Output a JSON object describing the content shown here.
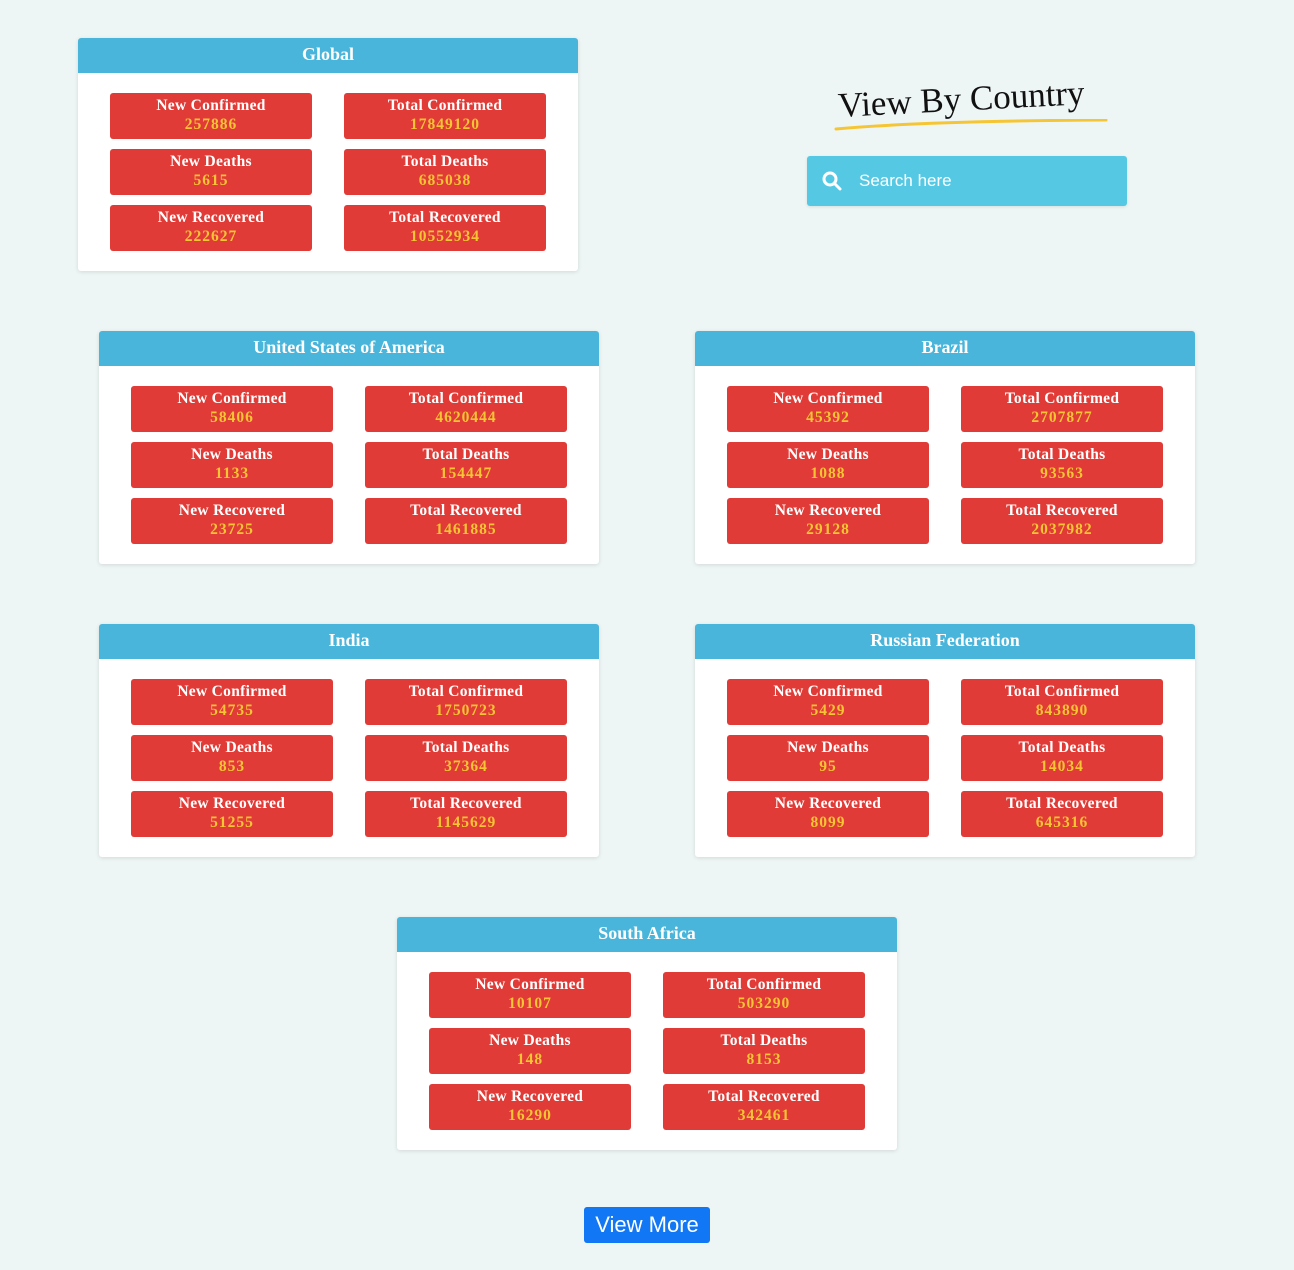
{
  "search": {
    "title": "View By Country",
    "placeholder": "Search here"
  },
  "labels": {
    "new_confirmed": "New Confirmed",
    "total_confirmed": "Total Confirmed",
    "new_deaths": "New Deaths",
    "total_deaths": "Total Deaths",
    "new_recovered": "New Recovered",
    "total_recovered": "Total Recovered"
  },
  "global": {
    "name": "Global",
    "new_confirmed": "257886",
    "total_confirmed": "17849120",
    "new_deaths": "5615",
    "total_deaths": "685038",
    "new_recovered": "222627",
    "total_recovered": "10552934"
  },
  "countries": [
    {
      "name": "United States of America",
      "new_confirmed": "58406",
      "total_confirmed": "4620444",
      "new_deaths": "1133",
      "total_deaths": "154447",
      "new_recovered": "23725",
      "total_recovered": "1461885"
    },
    {
      "name": "Brazil",
      "new_confirmed": "45392",
      "total_confirmed": "2707877",
      "new_deaths": "1088",
      "total_deaths": "93563",
      "new_recovered": "29128",
      "total_recovered": "2037982"
    },
    {
      "name": "India",
      "new_confirmed": "54735",
      "total_confirmed": "1750723",
      "new_deaths": "853",
      "total_deaths": "37364",
      "new_recovered": "51255",
      "total_recovered": "1145629"
    },
    {
      "name": "Russian Federation",
      "new_confirmed": "5429",
      "total_confirmed": "843890",
      "new_deaths": "95",
      "total_deaths": "14034",
      "new_recovered": "8099",
      "total_recovered": "645316"
    },
    {
      "name": "South Africa",
      "new_confirmed": "10107",
      "total_confirmed": "503290",
      "new_deaths": "148",
      "total_deaths": "8153",
      "new_recovered": "16290",
      "total_recovered": "342461"
    }
  ],
  "view_more_label": "View More",
  "colors": {
    "header": "#4ab5da",
    "stat_bg": "#e03b36",
    "stat_value": "#f5c533",
    "search_bg": "#55c9e4",
    "button": "#1177f4",
    "underline": "#f5c533"
  }
}
